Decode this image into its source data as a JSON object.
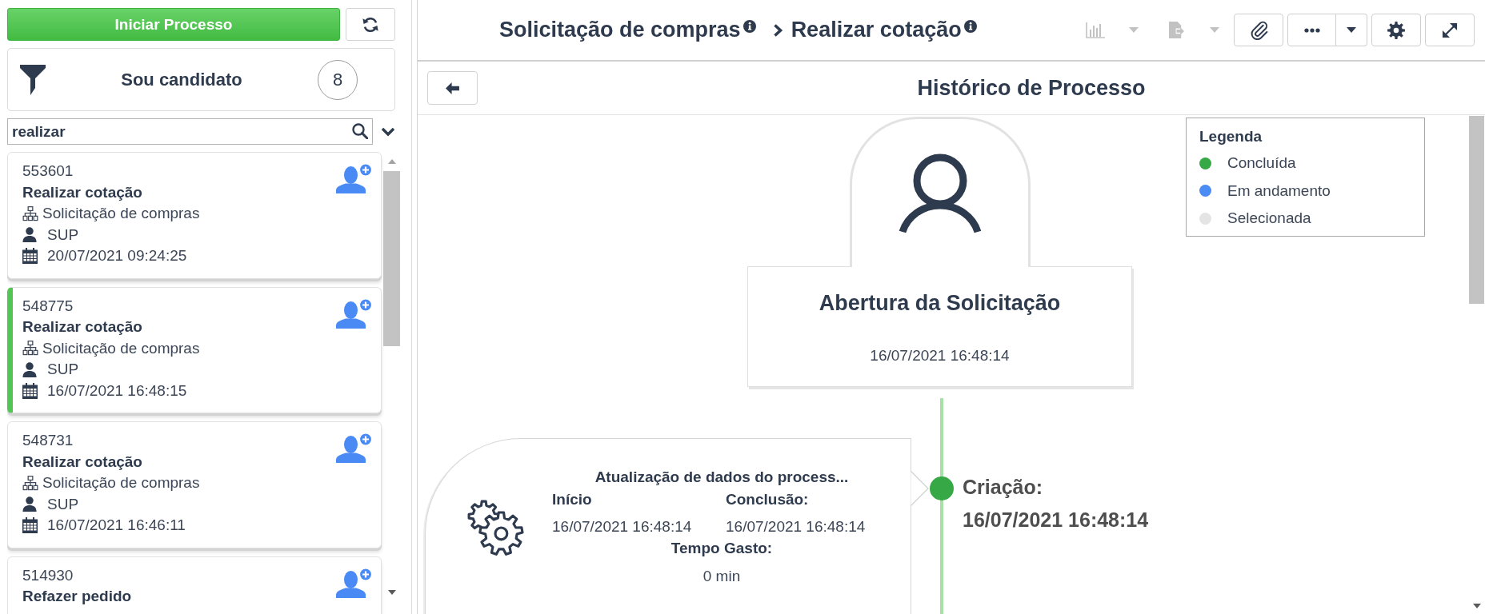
{
  "sidebar": {
    "start_button": "Iniciar Processo",
    "filter": {
      "title": "Sou candidato",
      "count": "8"
    },
    "search": {
      "value": "realizar"
    },
    "cards": [
      {
        "id": "553601",
        "title": "Realizar cotação",
        "process": "Solicitação de compras",
        "user": "SUP",
        "date": "20/07/2021 09:24:25",
        "selected": false
      },
      {
        "id": "548775",
        "title": "Realizar cotação",
        "process": "Solicitação de compras",
        "user": "SUP",
        "date": "16/07/2021 16:48:15",
        "selected": true
      },
      {
        "id": "548731",
        "title": "Realizar cotação",
        "process": "Solicitação de compras",
        "user": "SUP",
        "date": "16/07/2021 16:46:11",
        "selected": false
      },
      {
        "id": "514930",
        "title": "Refazer pedido",
        "selected": false
      }
    ]
  },
  "header": {
    "breadcrumb": [
      {
        "label": "Solicitação de compras"
      },
      {
        "label": "Realizar cotação"
      }
    ],
    "toolbar": [
      {
        "kind": "chart",
        "disabled": true,
        "dropdown": true
      },
      {
        "kind": "export",
        "disabled": true,
        "dropdown": true
      },
      {
        "kind": "attach",
        "disabled": false,
        "dropdown": false
      },
      {
        "kind": "more",
        "disabled": false,
        "dropdown": true
      },
      {
        "kind": "settings",
        "disabled": false,
        "dropdown": false
      },
      {
        "kind": "expand",
        "disabled": false,
        "dropdown": false
      }
    ]
  },
  "history": {
    "title": "Histórico de Processo",
    "legend": {
      "title": "Legenda",
      "items": [
        {
          "label": "Concluída",
          "color": "#37a846"
        },
        {
          "label": "Em andamento",
          "color": "#4b8bf4"
        },
        {
          "label": "Selecionada",
          "color": "#e4e4e4"
        }
      ]
    },
    "start_node": {
      "title": "Abertura da Solicitação",
      "date": "16/07/2021 16:48:14"
    },
    "events": [
      {
        "title": "Atualização de dados do process...",
        "start_label": "Início",
        "start": "16/07/2021 16:48:14",
        "end_label": "Conclusão:",
        "end": "16/07/2021 16:48:14",
        "duration_label": "Tempo Gasto:",
        "duration": "0 min",
        "marker_label": "Criação:",
        "marker_date": "16/07/2021 16:48:14",
        "color": "#37a846"
      }
    ]
  }
}
